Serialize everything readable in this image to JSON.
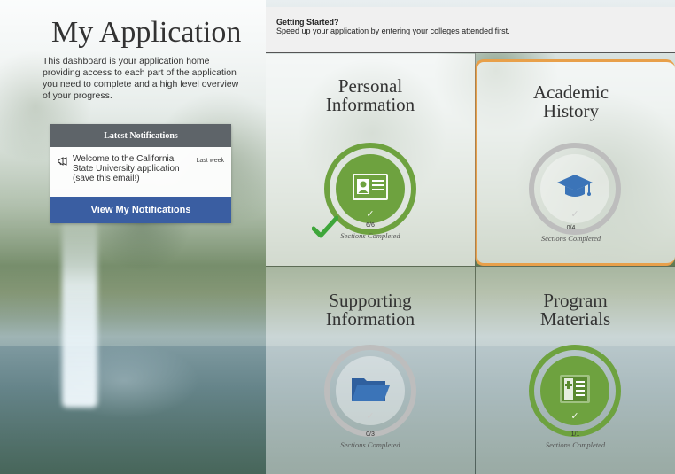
{
  "left": {
    "title": "My Application",
    "intro": "This dashboard is your application home providing access to each part of the application you need to complete and a high level overview of your progress."
  },
  "notifications": {
    "header": "Latest Notifications",
    "items": [
      {
        "icon": "megaphone-icon",
        "text": "Welcome to the California State University application (save this email!)",
        "time": "Last week"
      }
    ],
    "button_label": "View My Notifications"
  },
  "getting_started": {
    "title": "Getting Started?",
    "text": "Speed up your application by entering your colleges attended first."
  },
  "tiles": [
    {
      "title_line1": "Personal",
      "title_line2": "Information",
      "icon": "id-card-icon",
      "count": "6/6",
      "status": "Sections Completed",
      "completed": true,
      "progress": 1.0,
      "highlighted": false
    },
    {
      "title_line1": "Academic",
      "title_line2": "History",
      "icon": "graduation-cap-icon",
      "count": "0/4",
      "status": "Sections Completed",
      "completed": false,
      "progress": 0.0,
      "highlighted": true
    },
    {
      "title_line1": "Supporting",
      "title_line2": "Information",
      "icon": "folder-icon",
      "count": "0/3",
      "status": "Sections Completed",
      "completed": false,
      "progress": 0.0,
      "highlighted": false
    },
    {
      "title_line1": "Program",
      "title_line2": "Materials",
      "icon": "book-icon",
      "count": "1/1",
      "status": "Sections Completed",
      "completed": false,
      "progress": 1.0,
      "highlighted": false
    }
  ],
  "colors": {
    "accent_green": "#6ea23f",
    "button_blue": "#3a5ea2",
    "highlight_orange": "#e8a04a",
    "folder_blue": "#3b74b8"
  }
}
